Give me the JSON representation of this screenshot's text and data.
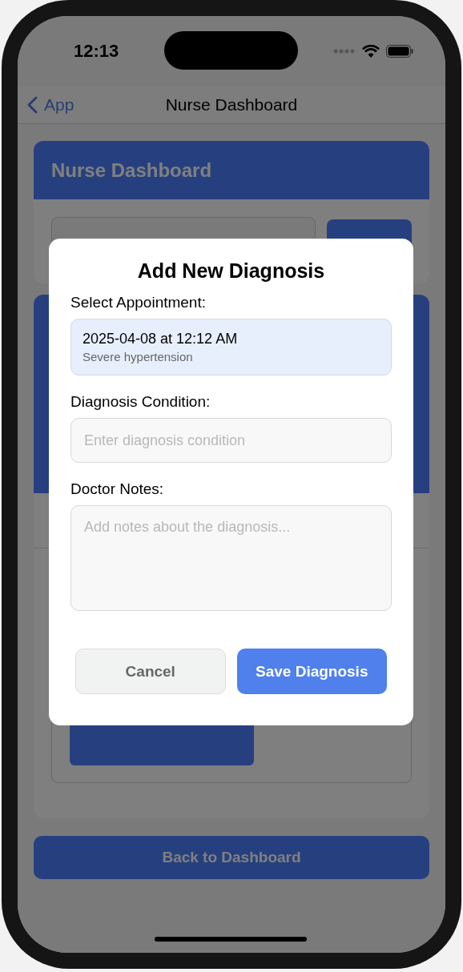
{
  "status_bar": {
    "time": "12:13"
  },
  "nav": {
    "back_label": "App",
    "title": "Nurse Dashboard"
  },
  "dashboard": {
    "title": "Nurse Dashboard",
    "back_button": "Back to Dashboard"
  },
  "dialog": {
    "title": "Add New Diagnosis",
    "appointment_label": "Select Appointment:",
    "appointments": [
      {
        "date": "2025-04-08 at 12:12 AM",
        "reason": "Severe hypertension",
        "selected": true
      }
    ],
    "condition": {
      "label": "Diagnosis Condition:",
      "placeholder": "Enter diagnosis condition"
    },
    "notes": {
      "label": "Doctor Notes:",
      "placeholder": "Add notes about the diagnosis..."
    },
    "buttons": [
      {
        "label": "Cancel",
        "kind": "secondary"
      },
      {
        "label": "Save Diagnosis",
        "kind": "primary"
      }
    ]
  }
}
